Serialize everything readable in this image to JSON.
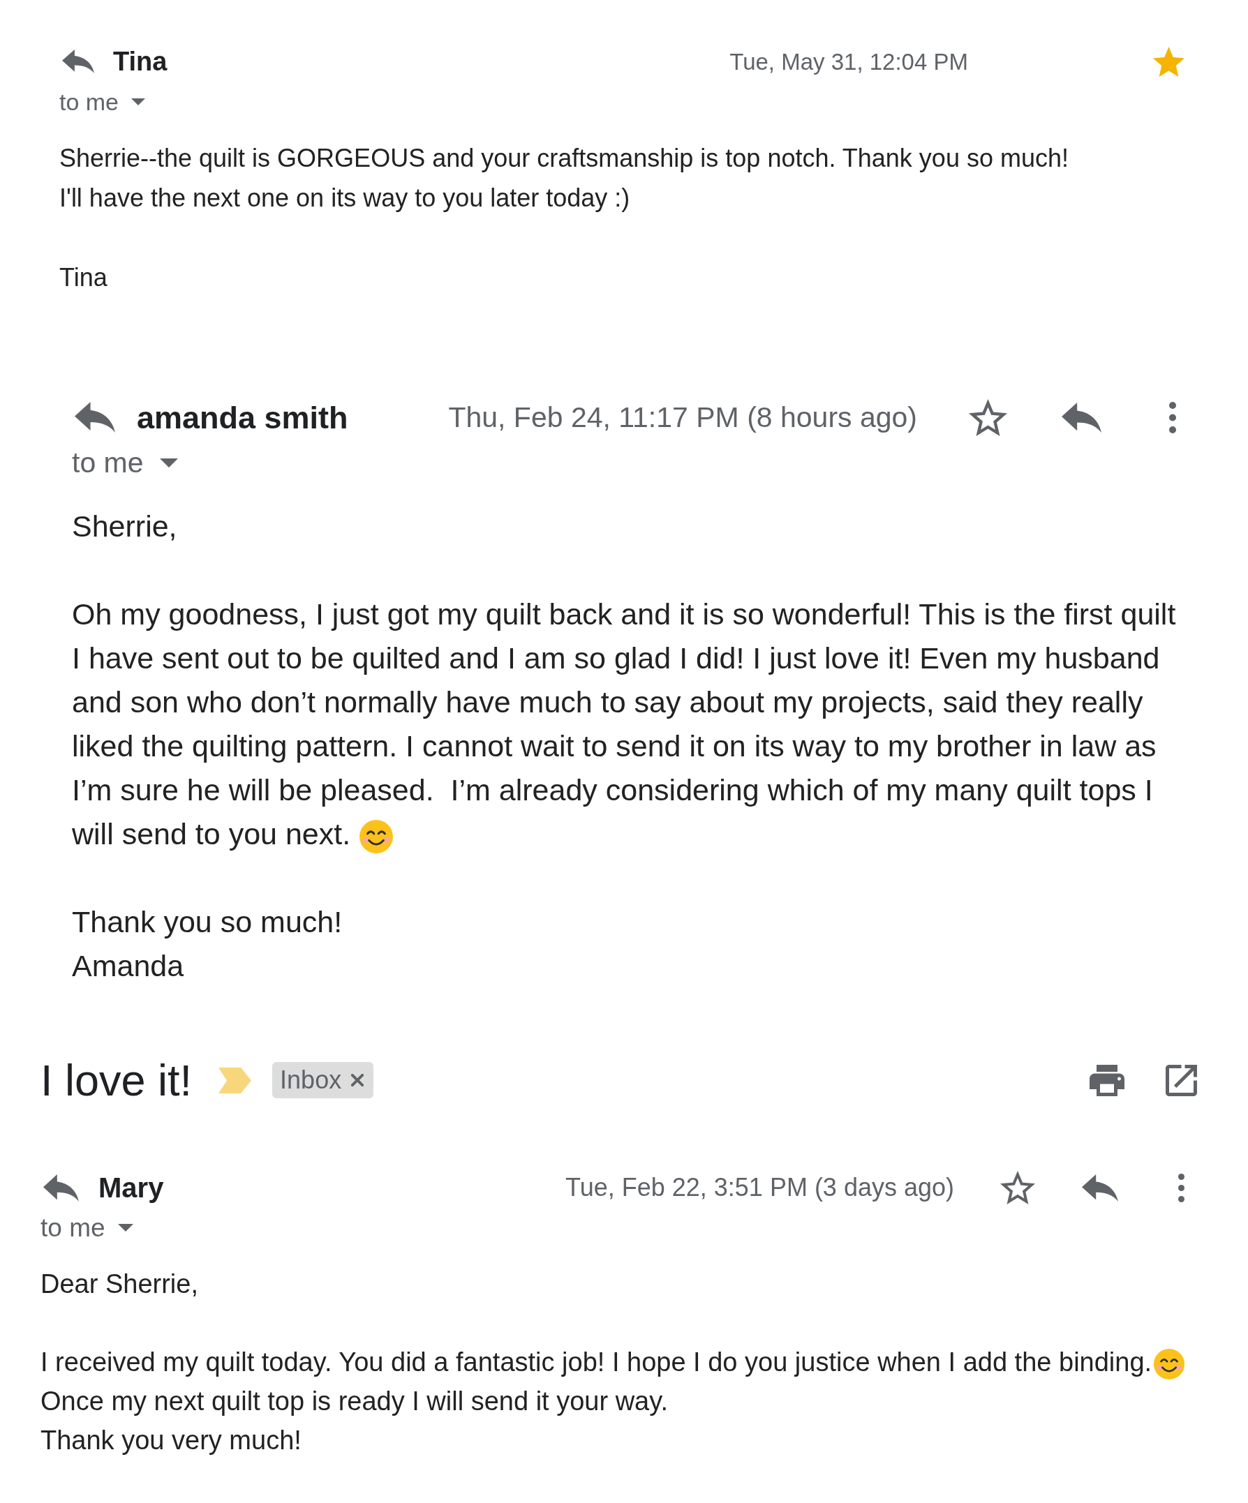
{
  "blocks": [
    {
      "kind": "message",
      "sender": "Tina",
      "date": "Tue, May 31, 12:04 PM",
      "starred": true,
      "actions": false,
      "recipient": "to me",
      "paragraphs": [
        {
          "lines": [
            {
              "text": "Sherrie--the quilt is GORGEOUS and your craftsmanship is top notch. Thank you so much!"
            },
            {
              "text": "I'll have the next one on its way to you later today :)"
            }
          ]
        },
        {
          "lines": [
            {
              "text": "Tina"
            }
          ]
        }
      ]
    },
    {
      "kind": "message",
      "sender": "amanda smith",
      "date": "Thu, Feb 24, 11:17 PM (8 hours ago)",
      "starred": false,
      "actions": true,
      "recipient": "to me",
      "paragraphs": [
        {
          "lines": [
            {
              "text": "Sherrie,"
            }
          ]
        },
        {
          "lines": [
            {
              "text": "Oh my goodness, I just got my quilt back and it is so wonderful! This is the first quilt"
            },
            {
              "text": "I have sent out to be quilted and I am so glad I did! I just love it! Even my husband"
            },
            {
              "text": "and son who don’t normally have much to say about my projects, said they really"
            },
            {
              "text": "liked the quilting pattern. I cannot wait to send it on its way to my brother in law as"
            },
            {
              "text": "I’m sure he will be pleased.  I’m already considering which of my many quilt tops I"
            },
            {
              "text": "will send to you next.",
              "emoji": true
            }
          ]
        },
        {
          "lines": [
            {
              "text": "Thank you so much!"
            },
            {
              "text": "Amanda"
            }
          ]
        }
      ]
    },
    {
      "kind": "thread_header",
      "subject": "I love it!",
      "important": true,
      "labels": [
        {
          "text": "Inbox"
        }
      ]
    },
    {
      "kind": "message",
      "sender": "Mary",
      "date": "Tue, Feb 22, 3:51 PM (3 days ago)",
      "starred": false,
      "actions": true,
      "recipient": "to me",
      "paragraphs": [
        {
          "lines": [
            {
              "text": "Dear Sherrie,"
            }
          ]
        },
        {
          "lines": [
            {
              "text": "I received my quilt today. You did a fantastic job! I hope I do you justice when I add the binding.",
              "emoji": true
            },
            {
              "text": "Once my next quilt top is ready I will send it your way."
            },
            {
              "text": "Thank you very much!"
            }
          ]
        }
      ]
    }
  ]
}
